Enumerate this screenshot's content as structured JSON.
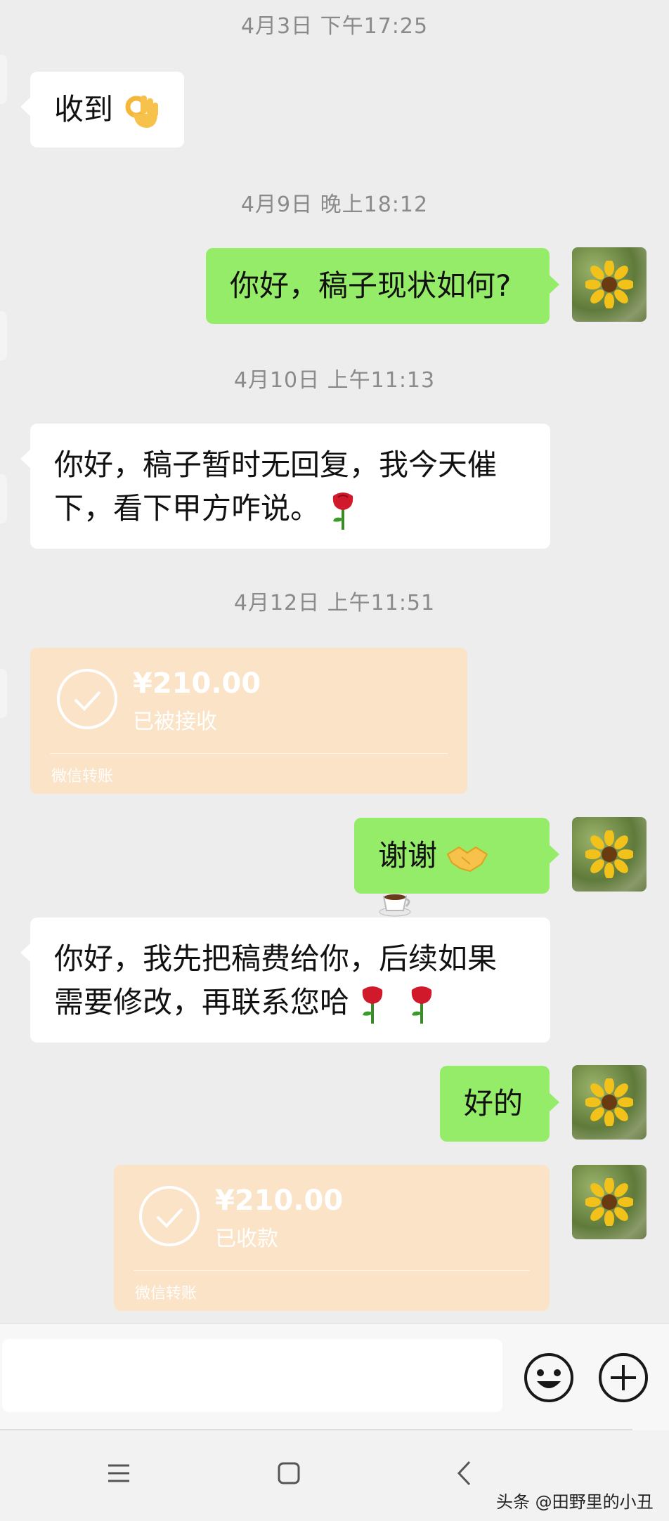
{
  "timestamps": [
    "4月3日 下午17:25",
    "4月9日 晚上18:12",
    "4月10日 上午11:13",
    "4月12日 上午11:51"
  ],
  "messages": {
    "m1": "收到",
    "m2": "你好，稿子现状如何?",
    "m3_line1": "你好，稿子暂时无回复，我今天催",
    "m3_line2": "下，看下甲方咋说。",
    "m5": "谢谢",
    "m6_line1": "你好，我先把稿费给你，后续如果",
    "m6_line2": "需要修改，再联系您哈",
    "m7": "好的"
  },
  "transfers": [
    {
      "amount": "¥210.00",
      "status": "已被接收",
      "brand": "微信转账"
    },
    {
      "amount": "¥210.00",
      "status": "已收款",
      "brand": "微信转账"
    }
  ],
  "icons": {
    "ok_hand": "ok-hand-emoji",
    "rose": "rose-emoji",
    "handshake": "handshake-emoji",
    "coffee": "coffee-emoji",
    "emoji_button": "emoji-face-icon",
    "add_button": "plus-circle-icon",
    "nav_menu": "menu-icon",
    "nav_home": "home-icon",
    "nav_back": "back-icon"
  },
  "input": {
    "value": "",
    "placeholder": ""
  },
  "watermark": "头条 @田野里的小丑",
  "colors": {
    "sent": "#95ec69",
    "received": "#ffffff",
    "background": "#ededed",
    "transfer": "#fbe3c8"
  }
}
